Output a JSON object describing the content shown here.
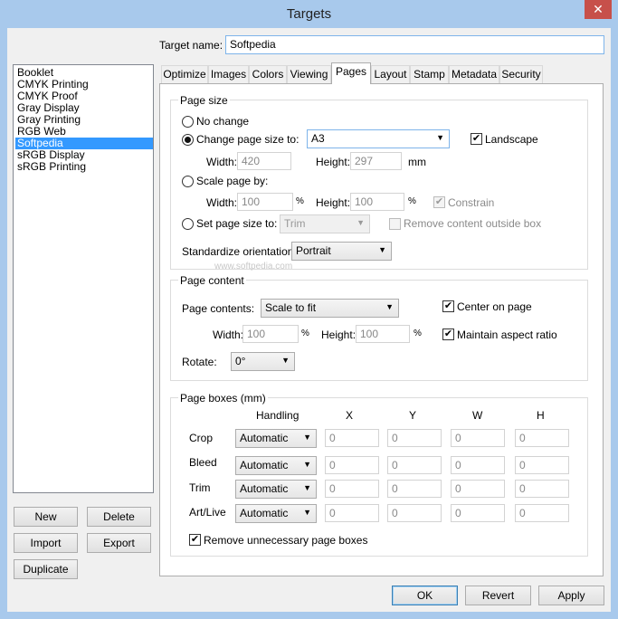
{
  "window": {
    "title": "Targets",
    "close_glyph": "✕"
  },
  "target_name": {
    "label": "Target name:",
    "value": "Softpedia"
  },
  "targets_list": [
    "Booklet",
    "CMYK Printing",
    "CMYK Proof",
    "Gray Display",
    "Gray Printing",
    "RGB Web",
    "Softpedia",
    "sRGB Display",
    "sRGB Printing"
  ],
  "targets_selected": "Softpedia",
  "left_buttons": {
    "new": "New",
    "delete": "Delete",
    "import": "Import",
    "export": "Export",
    "duplicate": "Duplicate"
  },
  "tabs": [
    "Optimize",
    "Images",
    "Colors",
    "Viewing",
    "Pages",
    "Layout",
    "Stamp",
    "Metadata",
    "Security"
  ],
  "active_tab": "Pages",
  "page_size": {
    "title": "Page size",
    "no_change": "No change",
    "change_to": "Change page size to:",
    "paper": "A3",
    "landscape": "Landscape",
    "width_label": "Width:",
    "width_value": "420",
    "height_label": "Height:",
    "height_value": "297",
    "unit": "mm",
    "scale_by": "Scale page by:",
    "scale_width_label": "Width:",
    "scale_width_value": "100",
    "scale_height_label": "Height:",
    "scale_height_value": "100",
    "percent": "%",
    "constrain": "Constrain",
    "set_to": "Set page size to:",
    "set_box": "Trim",
    "remove_outside": "Remove content outside box",
    "standardize_label": "Standardize orientation:",
    "standardize_value": "Portrait"
  },
  "page_content": {
    "title": "Page content",
    "contents_label": "Page contents:",
    "contents_value": "Scale to fit",
    "center": "Center on page",
    "maintain": "Maintain aspect ratio",
    "width_label": "Width:",
    "width_value": "100",
    "height_label": "Height:",
    "height_value": "100",
    "percent": "%",
    "rotate_label": "Rotate:",
    "rotate_value": "0°"
  },
  "page_boxes": {
    "title": "Page boxes (mm)",
    "headers": [
      "Handling",
      "X",
      "Y",
      "W",
      "H"
    ],
    "rows": [
      {
        "name": "Crop",
        "handling": "Automatic",
        "x": "0",
        "y": "0",
        "w": "0",
        "h": "0"
      },
      {
        "name": "Bleed",
        "handling": "Automatic",
        "x": "0",
        "y": "0",
        "w": "0",
        "h": "0"
      },
      {
        "name": "Trim",
        "handling": "Automatic",
        "x": "0",
        "y": "0",
        "w": "0",
        "h": "0"
      },
      {
        "name": "Art/Live",
        "handling": "Automatic",
        "x": "0",
        "y": "0",
        "w": "0",
        "h": "0"
      }
    ],
    "remove_unnecessary": "Remove unnecessary page boxes"
  },
  "footer": {
    "ok": "OK",
    "revert": "Revert",
    "apply": "Apply"
  },
  "watermark": "www.softpedia.com",
  "colors": {
    "selection": "#3399ff",
    "titlebar": "#a8c9ec",
    "close": "#c7504a"
  }
}
